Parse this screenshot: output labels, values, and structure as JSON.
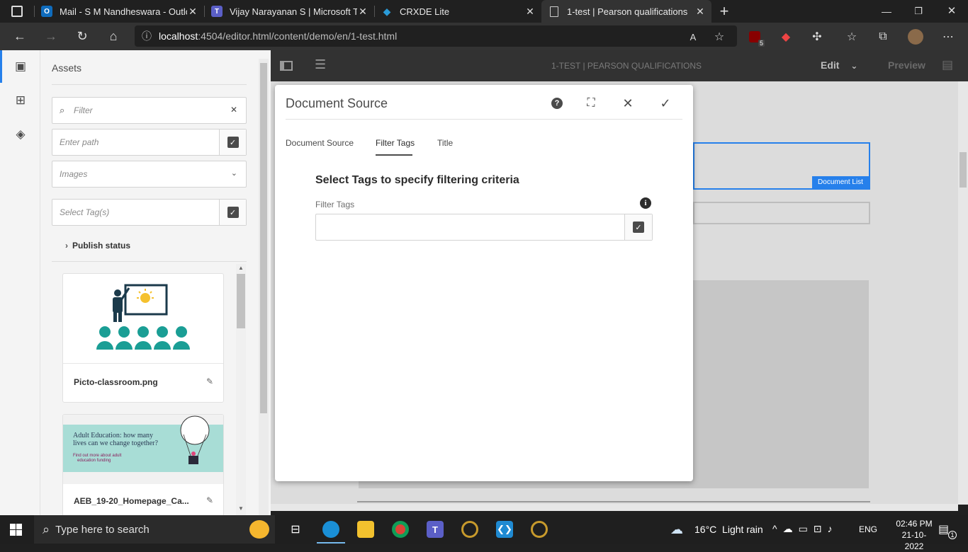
{
  "browser": {
    "tabs": [
      {
        "label": "Mail - S M Nandheswara - Outlo",
        "icon": "outlook-icon",
        "icon_glyph": "O",
        "color": "#0f6cbd"
      },
      {
        "label": "Vijay Narayanan S | Microsoft Te",
        "icon": "teams-icon",
        "icon_glyph": "T",
        "color": "#5b5fc7"
      },
      {
        "label": "CRXDE Lite",
        "icon": "crxde-icon",
        "icon_glyph": "◆",
        "color": "#2a9bd8"
      },
      {
        "label": "1-test | Pearson qualifications",
        "icon": "page-icon",
        "icon_glyph": "▯",
        "color": "#333333"
      }
    ],
    "new_tab_glyph": "+",
    "url_host": "localhost",
    "url_rest": ":4504/editor.html/content/demo/en/1-test.html"
  },
  "assets_panel": {
    "title": "Assets",
    "filter_placeholder": "Filter",
    "path_placeholder": "Enter path",
    "type_select": "Images",
    "tags_placeholder": "Select Tag(s)",
    "publish_status": "Publish status",
    "cards": [
      {
        "name": "Picto-classroom.png"
      },
      {
        "name": "AEB_19-20_Homepage_Ca...",
        "thumb_text_1": "Adult Education: how many",
        "thumb_text_2": "lives can we change together?",
        "thumb_link_1": "Find out more about adult",
        "thumb_link_2": "education funding"
      }
    ]
  },
  "editor": {
    "page_title": "1-TEST | PEARSON QUALIFICATIONS",
    "mode": "Edit",
    "preview": "Preview",
    "component_badge": "Document List"
  },
  "dialog": {
    "title": "Document Source",
    "tabs": [
      "Document Source",
      "Filter Tags",
      "Title"
    ],
    "active_tab": "Filter Tags",
    "heading": "Select Tags to specify filtering criteria",
    "field_label": "Filter Tags"
  },
  "taskbar": {
    "search_placeholder": "Type here to search",
    "weather": "16°C  Light rain",
    "lang": "ENG",
    "time": "02:46 PM",
    "date": "21-10-2022",
    "notif_count": "1"
  },
  "extension_badge": "5",
  "colors": {
    "accent": "#2680eb",
    "aem_dark": "#323232",
    "people": "#1a9e95"
  }
}
